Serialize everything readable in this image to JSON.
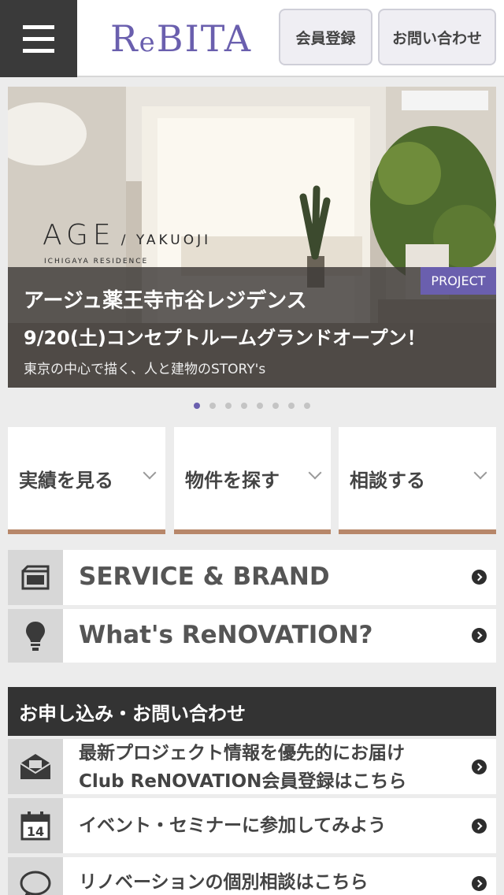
{
  "header": {
    "menu_icon": "hamburger-menu-icon",
    "logo_first": "R",
    "logo_mid": "e",
    "logo_rest": "BITA",
    "register_label": "会員登録",
    "contact_label": "お問い合わせ"
  },
  "hero": {
    "logo_title": "AGE",
    "logo_sub": "/ YAKUOJI",
    "logo_small": "ICHIGAYA RESIDENCE",
    "badge": "PROJECT",
    "title": "アージュ薬王寺市谷レジデンス",
    "subtitle": "9/20(土)コンセプトルームグランドオープン！",
    "description": "東京の中心で描く、人と建物のSTORY's",
    "slide_count": 8,
    "active_slide": 1
  },
  "tiles": [
    {
      "label": "実績を見る"
    },
    {
      "label": "物件を探す"
    },
    {
      "label": "相談する"
    }
  ],
  "links": [
    {
      "label": "SERVICE & BRAND",
      "icon": "folder-icon"
    },
    {
      "label": "What's ReNOVATION?",
      "icon": "lightbulb-icon"
    }
  ],
  "contact_section": {
    "title": "お申し込み・お問い合わせ",
    "items": [
      {
        "line1": "最新プロジェクト情報を優先的にお届け",
        "line2": "Club ReNOVATION会員登録はこちら",
        "icon": "mail-icon"
      },
      {
        "line1": "イベント・セミナーに参加してみよう",
        "icon": "calendar-icon",
        "calendar_day": "14"
      },
      {
        "line1": "リノベーションの個別相談はこちら",
        "icon": "chat-bubble-icon"
      }
    ]
  },
  "colors": {
    "brand": "#6a5fae",
    "accent": "#b7876a",
    "dark": "#333333"
  }
}
